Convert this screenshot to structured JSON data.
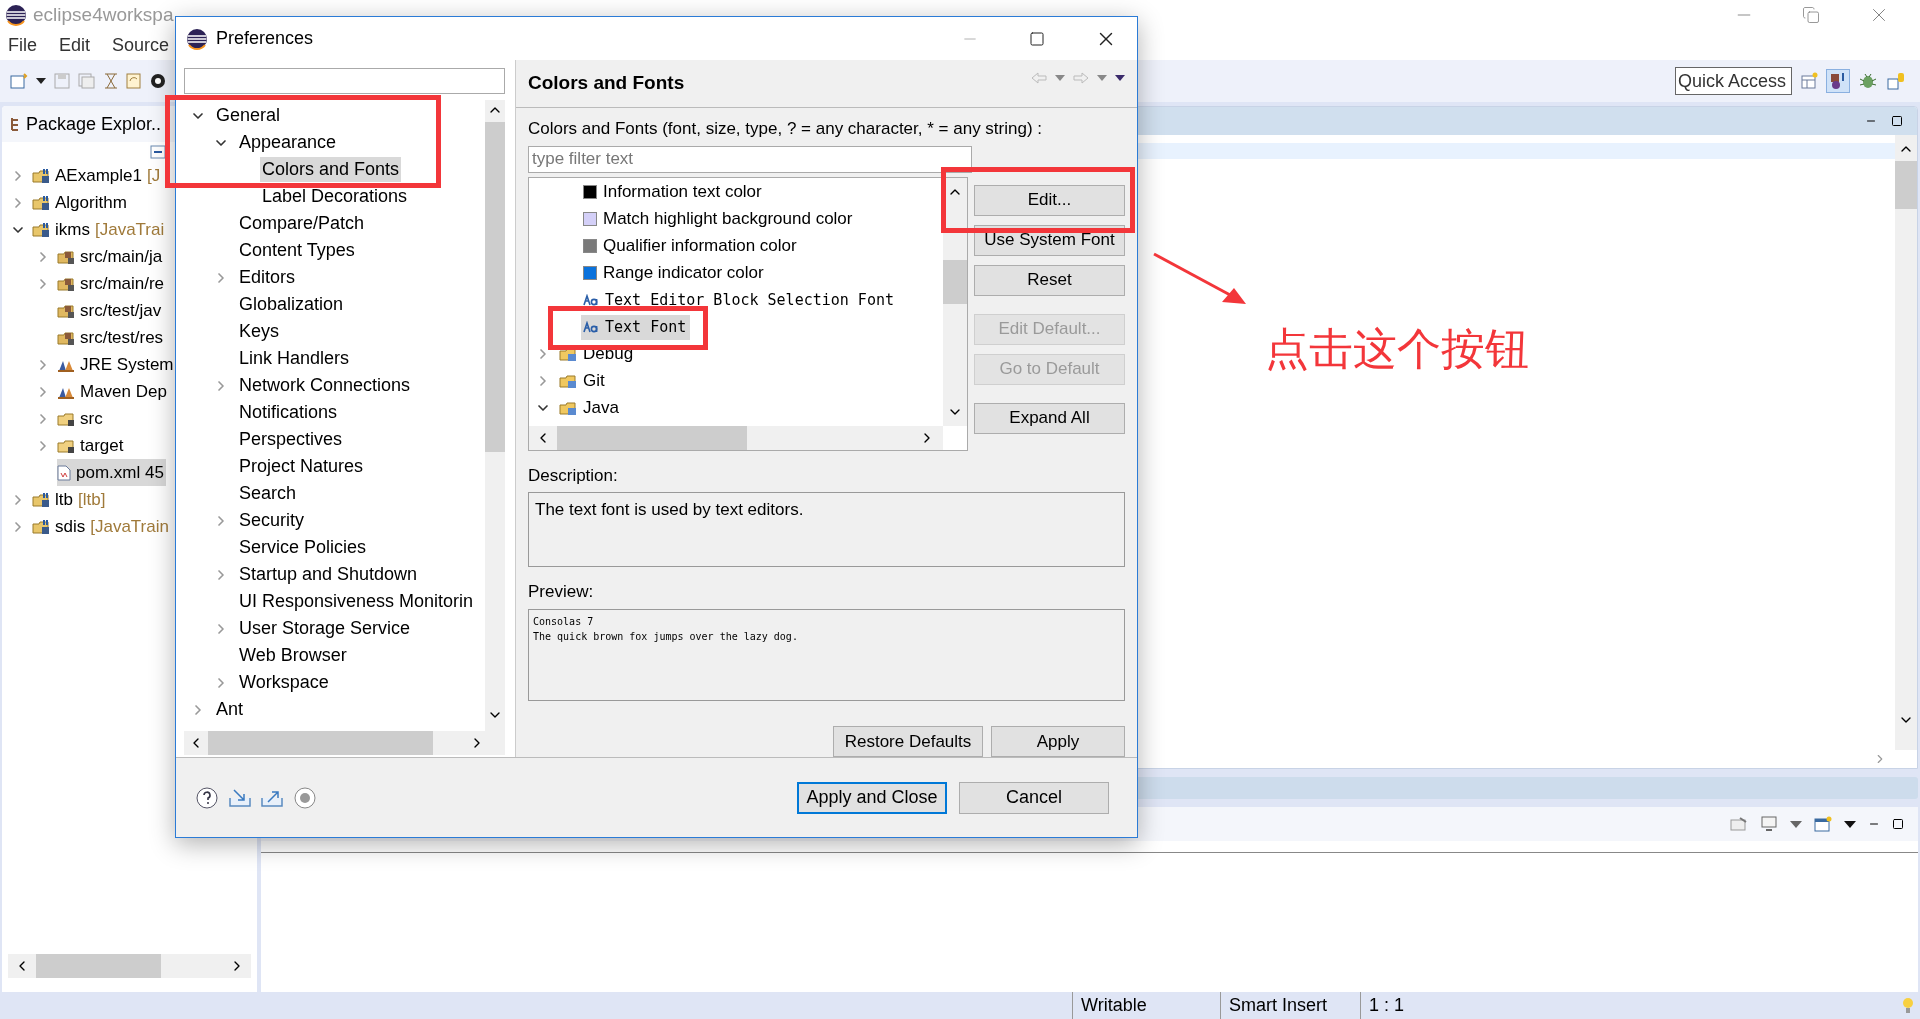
{
  "window": {
    "title": "eclipse4workspa"
  },
  "menu": [
    "File",
    "Edit",
    "Source"
  ],
  "quick_access": {
    "placeholder": "Quick Access"
  },
  "package_explorer": {
    "title": "Package Explor..",
    "items": [
      {
        "name": "AExample1",
        "decoration": "[J",
        "kind": "project",
        "expanded": false,
        "selected": false
      },
      {
        "name": "Algorithm",
        "kind": "project",
        "expanded": false,
        "selected": false
      },
      {
        "name": "ikms",
        "decoration": "[JavaTrai",
        "kind": "project",
        "expanded": true,
        "selected": false,
        "children": [
          {
            "name": "src/main/ja",
            "kind": "source",
            "expanded": false,
            "selected": false
          },
          {
            "name": "src/main/re",
            "kind": "source",
            "expanded": false,
            "selected": false
          },
          {
            "name": "src/test/jav",
            "kind": "source",
            "selected": false
          },
          {
            "name": "src/test/res",
            "kind": "source",
            "selected": false
          },
          {
            "name": "JRE System",
            "kind": "library",
            "expanded": false,
            "selected": false
          },
          {
            "name": "Maven Dep",
            "kind": "library",
            "expanded": false,
            "selected": false
          },
          {
            "name": "src",
            "kind": "folder",
            "expanded": false,
            "selected": false
          },
          {
            "name": "target",
            "kind": "folder",
            "expanded": false,
            "selected": false
          },
          {
            "name": "pom.xml 45",
            "kind": "file",
            "selected": true
          }
        ]
      },
      {
        "name": "ltb",
        "decoration": "[ltb]",
        "kind": "project",
        "expanded": false,
        "selected": false
      },
      {
        "name": "sdis",
        "decoration": "[JavaTrain",
        "kind": "project",
        "expanded": false,
        "selected": false
      }
    ]
  },
  "dialog": {
    "title": "Preferences",
    "tree": [
      {
        "label": "General",
        "expanded": true,
        "selected": false,
        "children": [
          {
            "label": "Appearance",
            "expanded": true,
            "selected": false,
            "children": [
              {
                "label": "Colors and Fonts",
                "selected": true
              },
              {
                "label": "Label Decorations",
                "selected": false
              }
            ]
          },
          {
            "label": "Compare/Patch",
            "selected": false
          },
          {
            "label": "Content Types",
            "selected": false
          },
          {
            "label": "Editors",
            "expanded": false,
            "selected": false
          },
          {
            "label": "Globalization",
            "selected": false
          },
          {
            "label": "Keys",
            "selected": false
          },
          {
            "label": "Link Handlers",
            "selected": false
          },
          {
            "label": "Network Connections",
            "expanded": false,
            "selected": false
          },
          {
            "label": "Notifications",
            "selected": false
          },
          {
            "label": "Perspectives",
            "selected": false
          },
          {
            "label": "Project Natures",
            "selected": false
          },
          {
            "label": "Search",
            "selected": false
          },
          {
            "label": "Security",
            "expanded": false,
            "selected": false
          },
          {
            "label": "Service Policies",
            "selected": false
          },
          {
            "label": "Startup and Shutdown",
            "expanded": false,
            "selected": false
          },
          {
            "label": "UI Responsiveness Monitorin",
            "selected": false
          },
          {
            "label": "User Storage Service",
            "expanded": false,
            "selected": false
          },
          {
            "label": "Web Browser",
            "selected": false
          },
          {
            "label": "Workspace",
            "expanded": false,
            "selected": false
          }
        ]
      },
      {
        "label": "Ant",
        "expanded": false,
        "selected": false
      }
    ],
    "page": {
      "title": "Colors and Fonts",
      "instructions": "Colors and Fonts (font, size, type, ? = any character, * = any string) :",
      "filter": {
        "placeholder": "type filter text"
      },
      "items": [
        {
          "kind": "color",
          "label": "Information text color",
          "color": "#000000",
          "selected": false
        },
        {
          "kind": "color",
          "label": "Match highlight background color",
          "color": "#d4d0f8",
          "selected": false
        },
        {
          "kind": "color",
          "label": "Qualifier information color",
          "color": "#7a7a7a",
          "selected": false
        },
        {
          "kind": "color",
          "label": "Range indicator color",
          "color": "#0a72dc",
          "selected": false
        },
        {
          "kind": "font",
          "label": "Text Editor Block Selection Font",
          "selected": false
        },
        {
          "kind": "font",
          "label": "Text Font",
          "selected": true
        },
        {
          "kind": "category",
          "label": "Debug",
          "expanded": false,
          "selected": false
        },
        {
          "kind": "category",
          "label": "Git",
          "expanded": false,
          "selected": false
        },
        {
          "kind": "category",
          "label": "Java",
          "expanded": true,
          "selected": false
        }
      ],
      "button_groups": [
        [
          {
            "label": "Edit...",
            "disabled": false
          },
          {
            "label": "Use System Font",
            "disabled": false
          },
          {
            "label": "Reset",
            "disabled": false
          }
        ],
        [
          {
            "label": "Edit Default...",
            "disabled": true
          },
          {
            "label": "Go to Default",
            "disabled": true
          }
        ],
        [
          {
            "label": "Expand All",
            "disabled": false
          }
        ]
      ],
      "description_label": "Description:",
      "description": "The text font is used by text editors.",
      "preview_label": "Preview:",
      "preview": [
        "Consolas 7",
        "The quick brown fox jumps over the lazy dog."
      ],
      "footer_buttons": [
        "Restore Defaults",
        "Apply"
      ]
    },
    "buttons": [
      {
        "label": "Apply and Close",
        "default": true
      },
      {
        "label": "Cancel",
        "default": false
      }
    ]
  },
  "status_bar": [
    "Writable",
    "Smart Insert",
    "1 : 1"
  ],
  "annotation": {
    "text": "点击这个按钮"
  }
}
